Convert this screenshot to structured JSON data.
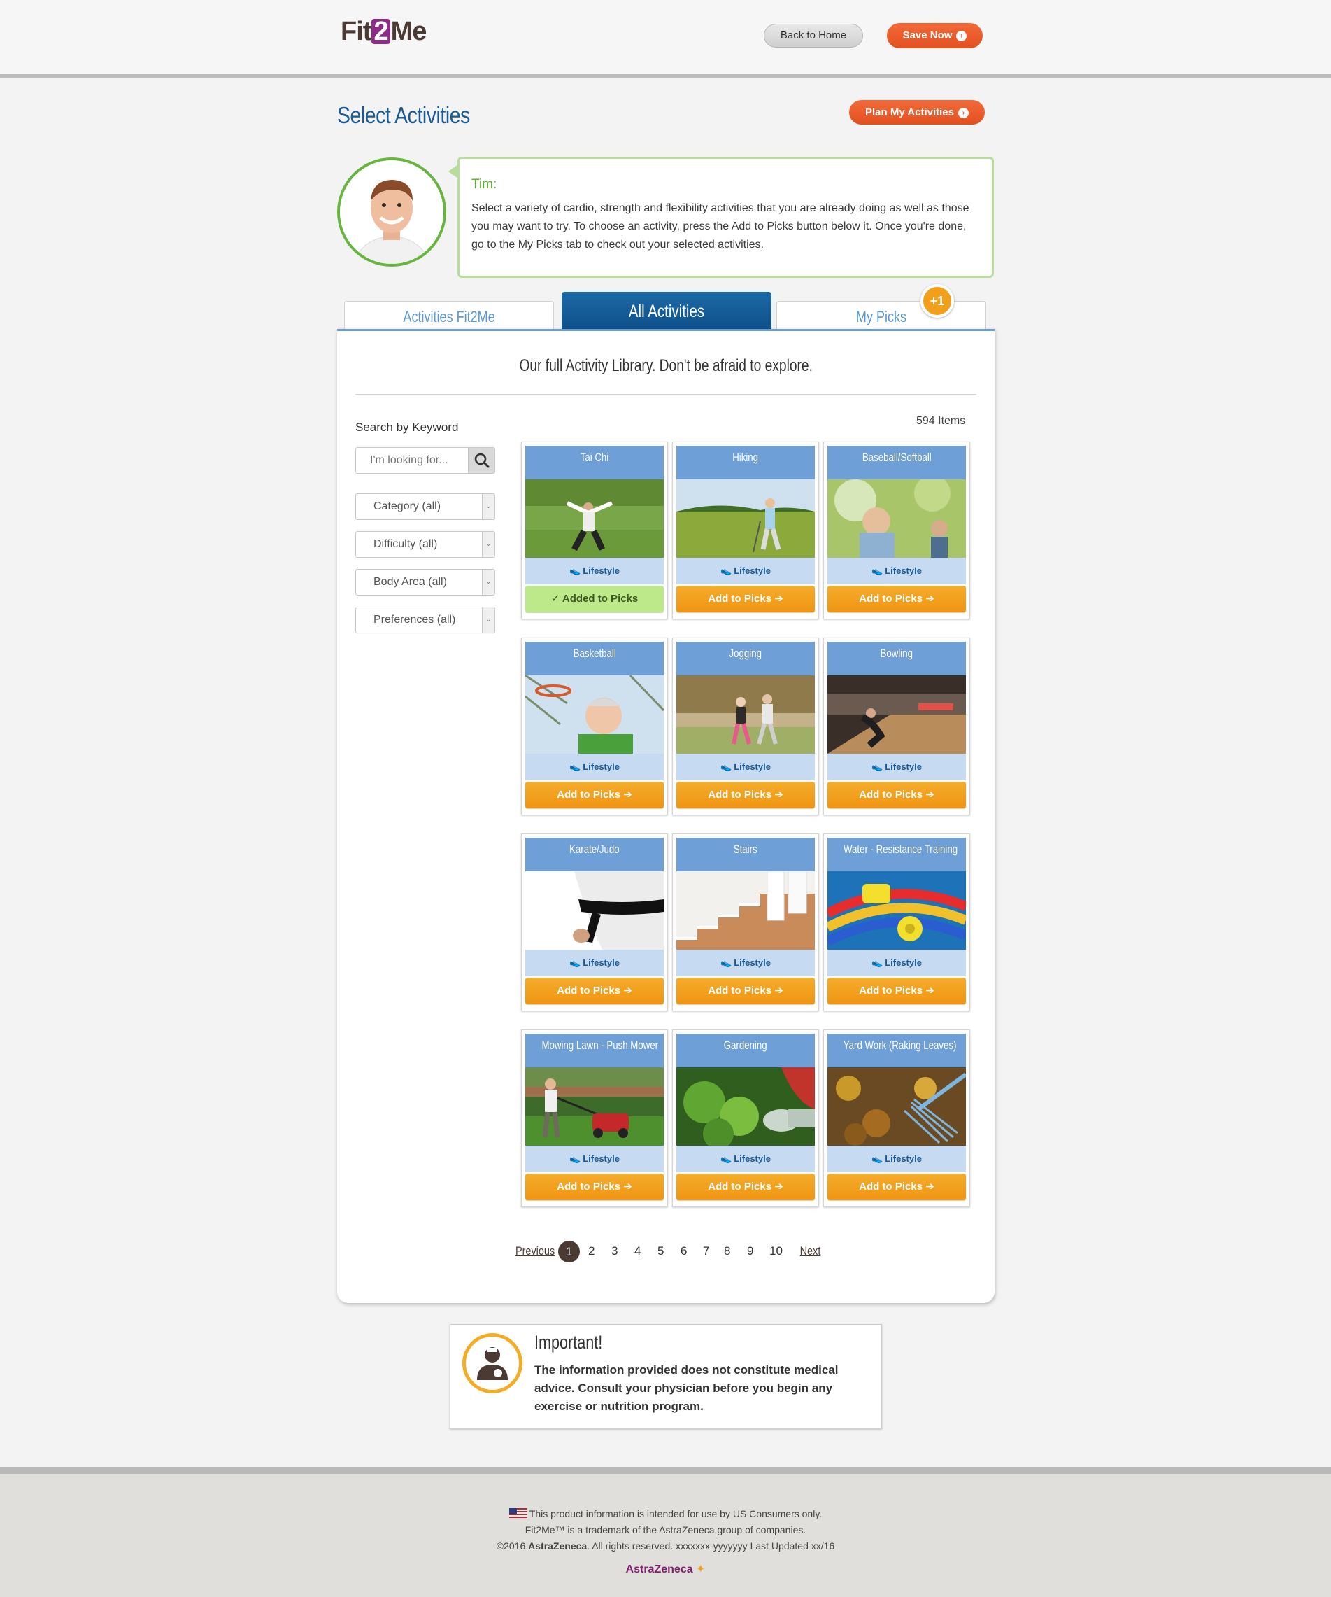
{
  "header": {
    "logo": {
      "pre": "Fit",
      "two": "2",
      "post": "Me"
    },
    "back_label": "Back to Home",
    "save_label": "Save Now"
  },
  "page": {
    "title": "Select Activities",
    "plan_label": "Plan My Activities"
  },
  "coach": {
    "name": "Tim:",
    "message": "Select a variety of cardio, strength and flexibility activities that you are already doing as well as those you may want to try. To choose an activity, press the Add to Picks button below it. Once you're done, go to the My Picks tab to check out your selected activities."
  },
  "tabs": [
    {
      "label": "Activities Fit2Me"
    },
    {
      "label": "All Activities"
    },
    {
      "label": "My Picks"
    }
  ],
  "picks_badge": "+1",
  "library": {
    "intro": "Our full Activity Library. Don't be afraid to explore.",
    "items_count": "594 Items"
  },
  "search": {
    "label": "Search by Keyword",
    "placeholder": "I'm looking for..."
  },
  "filters": [
    {
      "label": "Category (all)"
    },
    {
      "label": "Difficulty (all)"
    },
    {
      "label": "Body Area (all)"
    },
    {
      "label": "Preferences (all)"
    }
  ],
  "activities": [
    {
      "title": "Tai Chi",
      "category": "Lifestyle",
      "button": "Added to Picks",
      "added": true
    },
    {
      "title": "Hiking",
      "category": "Lifestyle",
      "button": "Add to Picks",
      "added": false
    },
    {
      "title": "Baseball/Softball",
      "category": "Lifestyle",
      "button": "Add to Picks",
      "added": false
    },
    {
      "title": "Basketball",
      "category": "Lifestyle",
      "button": "Add to Picks",
      "added": false
    },
    {
      "title": "Jogging",
      "category": "Lifestyle",
      "button": "Add to Picks",
      "added": false
    },
    {
      "title": "Bowling",
      "category": "Lifestyle",
      "button": "Add to Picks",
      "added": false
    },
    {
      "title": "Karate/Judo",
      "category": "Lifestyle",
      "button": "Add to Picks",
      "added": false
    },
    {
      "title": "Stairs",
      "category": "Lifestyle",
      "button": "Add to Picks",
      "added": false
    },
    {
      "title": "Water - Resistance Training",
      "category": "Lifestyle",
      "button": "Add to Picks",
      "added": false
    },
    {
      "title": "Mowing Lawn - Push Mower",
      "category": "Lifestyle",
      "button": "Add to Picks",
      "added": false
    },
    {
      "title": "Gardening",
      "category": "Lifestyle",
      "button": "Add to Picks",
      "added": false
    },
    {
      "title": "Yard Work (Raking Leaves)",
      "category": "Lifestyle",
      "button": "Add to Picks",
      "added": false
    }
  ],
  "pagination": {
    "previous": "Previous",
    "pages": [
      "1",
      "2",
      "3",
      "4",
      "5",
      "6",
      "7",
      "8",
      "9",
      "10"
    ],
    "current": "1",
    "next": "Next"
  },
  "important": {
    "title": "Important!",
    "text": "The information provided does not constitute medical advice. Consult your physician before you begin any exercise or nutrition program."
  },
  "footer": {
    "line1": "This product information is intended for use by US Consumers only.",
    "line2": "Fit2Me™ is a trademark of the AstraZeneca group of companies.",
    "line3_pre": "©2016 ",
    "line3_brand": "AstraZeneca",
    "line3_post": ". All rights reserved. xxxxxxx-yyyyyyy Last Updated xx/16",
    "logo_text": "AstraZeneca"
  },
  "colors": {
    "brand_orange": "#e4501f",
    "brand_blue": "#1b5a93",
    "coach_green": "#67b53e",
    "card_blue": "#6e9fd6",
    "add_orange": "#f39f1e",
    "added_green": "#bde98a"
  }
}
